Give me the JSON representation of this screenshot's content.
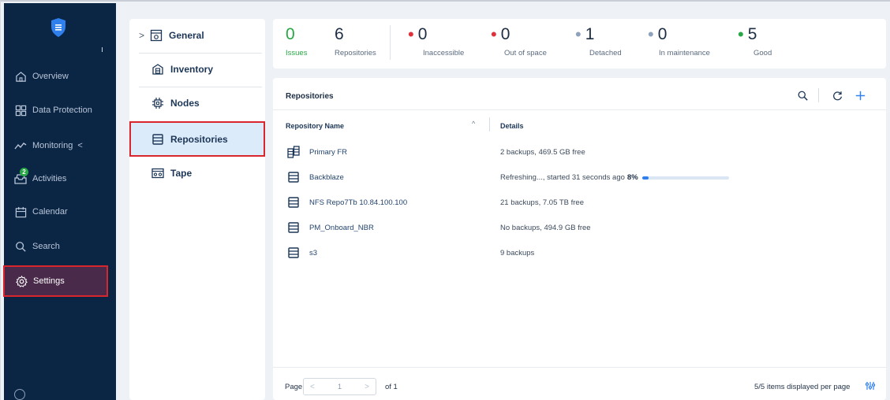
{
  "nav": {
    "items": [
      {
        "label": "Overview",
        "icon": "home-icon"
      },
      {
        "label": "Data Protection",
        "icon": "grid-icon"
      },
      {
        "label": "Monitoring",
        "icon": "pulse-icon"
      },
      {
        "label": "Activities",
        "icon": "inbox-icon",
        "badge": "2"
      },
      {
        "label": "Calendar",
        "icon": "calendar-icon"
      },
      {
        "label": "Search",
        "icon": "search-icon"
      },
      {
        "label": "Settings",
        "icon": "gear-icon"
      }
    ]
  },
  "settings_menu": {
    "items": [
      {
        "label": "General",
        "icon": "general-icon"
      },
      {
        "label": "Inventory",
        "icon": "inventory-icon"
      },
      {
        "label": "Nodes",
        "icon": "node-icon"
      },
      {
        "label": "Repositories",
        "icon": "repository-icon"
      },
      {
        "label": "Tape",
        "icon": "tape-icon"
      }
    ]
  },
  "summary": {
    "stats": [
      {
        "value": "0",
        "label": "Issues",
        "color": "#28a745"
      },
      {
        "value": "6",
        "label": "Repositories",
        "color": ""
      },
      {
        "value": "0",
        "label": "Inaccessible",
        "color": "#e0303a"
      },
      {
        "value": "0",
        "label": "Out of space",
        "color": "#e0303a"
      },
      {
        "value": "1",
        "label": "Detached",
        "color": "#8fa2bb"
      },
      {
        "value": "0",
        "label": "In maintenance",
        "color": "#8fa2bb"
      },
      {
        "value": "5",
        "label": "Good",
        "color": "#28a745"
      }
    ]
  },
  "main": {
    "title": "Repositories",
    "columns": {
      "name": "Repository Name",
      "details": "Details"
    },
    "rows": [
      {
        "name": "Primary FR",
        "details": "2 backups, 469.5 GB free",
        "icon": "repository-group-icon"
      },
      {
        "name": "Backblaze",
        "details": "Refreshing..., started 31 seconds ago",
        "progress_label": "8%",
        "progress": 0.08,
        "icon": "repository-icon"
      },
      {
        "name": "NFS Repo7Tb 10.84.100.100",
        "details": "21 backups, 7.05 TB free",
        "icon": "repository-icon"
      },
      {
        "name": "PM_Onboard_NBR",
        "details": "No backups, 494.9 GB free",
        "icon": "repository-icon"
      },
      {
        "name": "s3",
        "details": "9 backups",
        "icon": "repository-icon"
      }
    ]
  },
  "pagination": {
    "page_label": "Page",
    "current_page": "1",
    "of_label": "of 1",
    "per_page_text": "5/5 items displayed per page"
  },
  "colors": {
    "nav_bg": "#0b2545",
    "accent": "#2f80ed",
    "highlight_border": "#d9262c",
    "active_sub_bg": "#dcebf9"
  }
}
